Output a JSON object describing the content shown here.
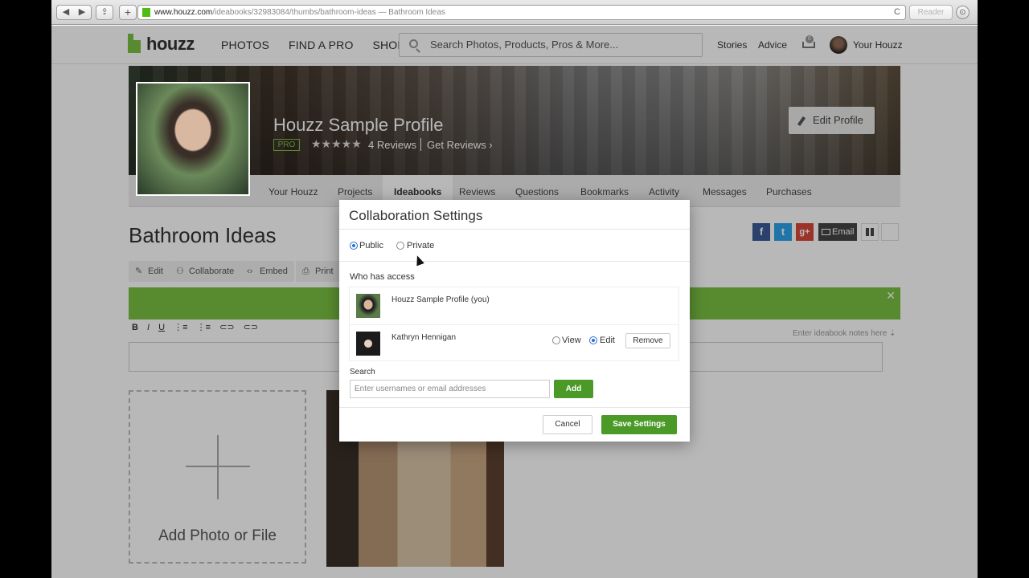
{
  "browser": {
    "back": "◀",
    "forward": "▶",
    "share": "⇪",
    "new_tab": "+",
    "url_host": "www.houzz.com",
    "url_path": "/ideabooks/32983084/thumbs/bathroom-ideas",
    "url_title": " — Bathroom Ideas",
    "reload": "C",
    "reader": "Reader",
    "download": "⊙"
  },
  "header": {
    "logo": "houzz",
    "nav": [
      "PHOTOS",
      "FIND A PRO",
      "SHOP"
    ],
    "search_placeholder": "Search Photos, Products, Pros & More...",
    "stories": "Stories",
    "advice": "Advice",
    "cart_count": "0",
    "your_houzz": "Your Houzz"
  },
  "profile": {
    "name": "Houzz Sample Profile",
    "pro_badge": "PRO",
    "stars": "★★★★★",
    "rating": 5,
    "reviews": "4 Reviews",
    "get_reviews": "Get Reviews ›",
    "edit_profile": "Edit Profile"
  },
  "tabs": [
    {
      "label": "Your Houzz"
    },
    {
      "label": "Projects"
    },
    {
      "label": "Ideabooks",
      "active": true
    },
    {
      "label": "Reviews"
    },
    {
      "label": "Questions"
    },
    {
      "label": "Bookmarks"
    },
    {
      "label": "Activity"
    },
    {
      "label": "Messages"
    },
    {
      "label": "Purchases"
    }
  ],
  "ideabook": {
    "title": "Bathroom Ideas",
    "actions": {
      "edit": "Edit",
      "collaborate": "Collaborate",
      "embed": "Embed",
      "print": "Print"
    },
    "close": "✕",
    "editor": {
      "bold": "B",
      "italic": "I",
      "underline": "U",
      "ordered": "⋮≡",
      "bullet": "⋮≡",
      "link": "⊂⊃",
      "unlink": "⊂⊃"
    },
    "notes_hint": "Enter ideabook notes here ⇣",
    "add_photo": "Add Photo or File",
    "social": {
      "facebook": "f",
      "twitter": "t",
      "google": "g+",
      "email": "Email"
    }
  },
  "modal": {
    "title": "Collaboration Settings",
    "visibility": {
      "public": "Public",
      "private": "Private",
      "selected": "Public"
    },
    "who_has_access": "Who has access",
    "members": [
      {
        "name": "Houzz Sample Profile (you)"
      },
      {
        "name": "Kathryn Hennigan",
        "view": "View",
        "edit": "Edit",
        "permission": "Edit",
        "remove": "Remove"
      }
    ],
    "search_label": "Search",
    "search_placeholder": "Enter usernames or email addresses",
    "add": "Add",
    "cancel": "Cancel",
    "save": "Save Settings"
  },
  "colors": {
    "brand_green": "#7ac142",
    "button_green": "#4b9a28",
    "radio_blue": "#2a6fd4",
    "facebook": "#3b5998",
    "twitter": "#2ca3e8",
    "google": "#d9473a"
  }
}
